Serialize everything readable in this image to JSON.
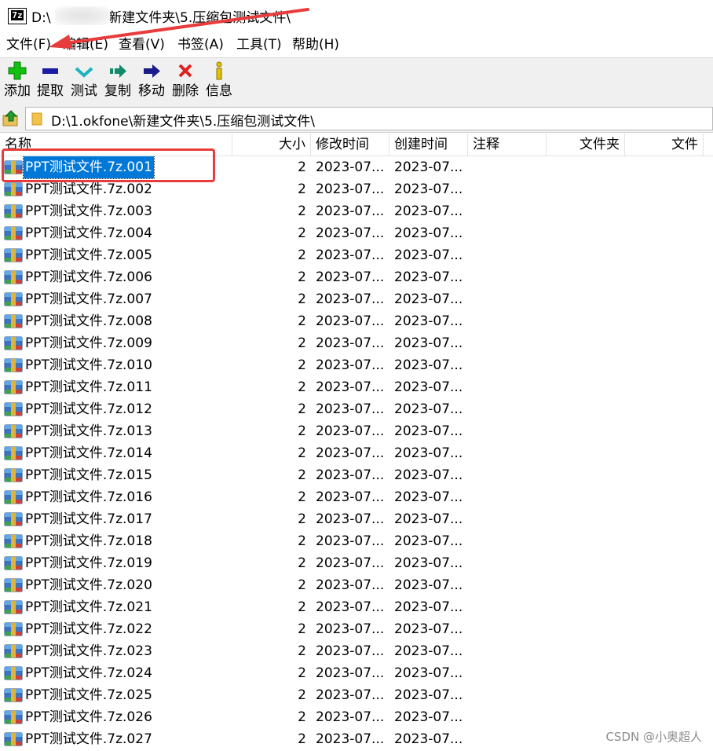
{
  "window": {
    "app_icon_text": "7z",
    "title_prefix": "D:\\",
    "title_suffix": "\\新建文件夹\\5.压缩包测试文件\\"
  },
  "menu": [
    "文件(F)",
    "编辑(E)",
    "查看(V)",
    "书签(A)",
    "工具(T)",
    "帮助(H)"
  ],
  "toolbar": [
    {
      "label": "添加",
      "icon": "add-icon",
      "color": "#12c012"
    },
    {
      "label": "提取",
      "icon": "extract-icon",
      "color": "#1a1aa6"
    },
    {
      "label": "测试",
      "icon": "test-icon",
      "color": "#1fb3c0"
    },
    {
      "label": "复制",
      "icon": "copy-icon",
      "color": "#138a6b"
    },
    {
      "label": "移动",
      "icon": "move-icon",
      "color": "#1a1a8c"
    },
    {
      "label": "删除",
      "icon": "delete-icon",
      "color": "#e02020"
    },
    {
      "label": "信息",
      "icon": "info-icon",
      "color": "#e3c100"
    }
  ],
  "address": {
    "path": "D:\\1.okfone\\新建文件夹\\5.压缩包测试文件\\"
  },
  "columns": [
    "名称",
    "大小",
    "修改时间",
    "创建时间",
    "注释",
    "文件夹",
    "文件"
  ],
  "files": [
    {
      "name": "PPT测试文件.7z.001",
      "size": "2",
      "modified": "2023-07...",
      "created": "2023-07..."
    },
    {
      "name": "PPT测试文件.7z.002",
      "size": "2",
      "modified": "2023-07...",
      "created": "2023-07..."
    },
    {
      "name": "PPT测试文件.7z.003",
      "size": "2",
      "modified": "2023-07...",
      "created": "2023-07..."
    },
    {
      "name": "PPT测试文件.7z.004",
      "size": "2",
      "modified": "2023-07...",
      "created": "2023-07..."
    },
    {
      "name": "PPT测试文件.7z.005",
      "size": "2",
      "modified": "2023-07...",
      "created": "2023-07..."
    },
    {
      "name": "PPT测试文件.7z.006",
      "size": "2",
      "modified": "2023-07...",
      "created": "2023-07..."
    },
    {
      "name": "PPT测试文件.7z.007",
      "size": "2",
      "modified": "2023-07...",
      "created": "2023-07..."
    },
    {
      "name": "PPT测试文件.7z.008",
      "size": "2",
      "modified": "2023-07...",
      "created": "2023-07..."
    },
    {
      "name": "PPT测试文件.7z.009",
      "size": "2",
      "modified": "2023-07...",
      "created": "2023-07..."
    },
    {
      "name": "PPT测试文件.7z.010",
      "size": "2",
      "modified": "2023-07...",
      "created": "2023-07..."
    },
    {
      "name": "PPT测试文件.7z.011",
      "size": "2",
      "modified": "2023-07...",
      "created": "2023-07..."
    },
    {
      "name": "PPT测试文件.7z.012",
      "size": "2",
      "modified": "2023-07...",
      "created": "2023-07..."
    },
    {
      "name": "PPT测试文件.7z.013",
      "size": "2",
      "modified": "2023-07...",
      "created": "2023-07..."
    },
    {
      "name": "PPT测试文件.7z.014",
      "size": "2",
      "modified": "2023-07...",
      "created": "2023-07..."
    },
    {
      "name": "PPT测试文件.7z.015",
      "size": "2",
      "modified": "2023-07...",
      "created": "2023-07..."
    },
    {
      "name": "PPT测试文件.7z.016",
      "size": "2",
      "modified": "2023-07...",
      "created": "2023-07..."
    },
    {
      "name": "PPT测试文件.7z.017",
      "size": "2",
      "modified": "2023-07...",
      "created": "2023-07..."
    },
    {
      "name": "PPT测试文件.7z.018",
      "size": "2",
      "modified": "2023-07...",
      "created": "2023-07..."
    },
    {
      "name": "PPT测试文件.7z.019",
      "size": "2",
      "modified": "2023-07...",
      "created": "2023-07..."
    },
    {
      "name": "PPT测试文件.7z.020",
      "size": "2",
      "modified": "2023-07...",
      "created": "2023-07..."
    },
    {
      "name": "PPT测试文件.7z.021",
      "size": "2",
      "modified": "2023-07...",
      "created": "2023-07..."
    },
    {
      "name": "PPT测试文件.7z.022",
      "size": "2",
      "modified": "2023-07...",
      "created": "2023-07..."
    },
    {
      "name": "PPT测试文件.7z.023",
      "size": "2",
      "modified": "2023-07...",
      "created": "2023-07..."
    },
    {
      "name": "PPT测试文件.7z.024",
      "size": "2",
      "modified": "2023-07...",
      "created": "2023-07..."
    },
    {
      "name": "PPT测试文件.7z.025",
      "size": "2",
      "modified": "2023-07...",
      "created": "2023-07..."
    },
    {
      "name": "PPT测试文件.7z.026",
      "size": "2",
      "modified": "2023-07...",
      "created": "2023-07..."
    },
    {
      "name": "PPT测试文件.7z.027",
      "size": "2",
      "modified": "2023-07...",
      "created": "2023-07..."
    }
  ],
  "selected_file": "PPT测试文件.7z.001",
  "annotation_color": "#e83b3b",
  "watermark": "CSDN @小奥超人"
}
